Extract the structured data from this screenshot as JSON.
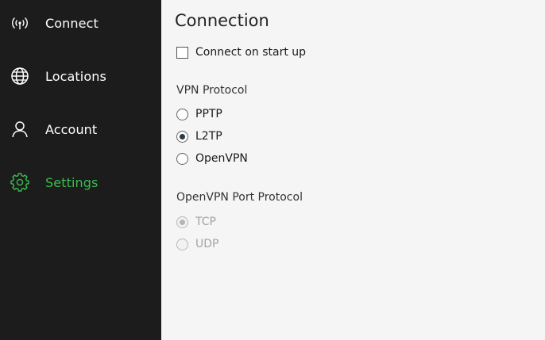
{
  "sidebar": {
    "items": [
      {
        "label": "Connect",
        "icon": "antenna-icon"
      },
      {
        "label": "Locations",
        "icon": "globe-icon"
      },
      {
        "label": "Account",
        "icon": "user-icon"
      },
      {
        "label": "Settings",
        "icon": "gear-icon",
        "active": true
      }
    ],
    "background": "#1c1c1c",
    "accent": "#3bbd4e"
  },
  "main": {
    "title": "Connection",
    "connect_on_startup": {
      "label": "Connect on start up",
      "checked": false
    },
    "vpn_protocol": {
      "label": "VPN Protocol",
      "options": [
        {
          "label": "PPTP",
          "checked": false
        },
        {
          "label": "L2TP",
          "checked": true
        },
        {
          "label": "OpenVPN",
          "checked": false
        }
      ]
    },
    "openvpn_port_protocol": {
      "label": "OpenVPN Port Protocol",
      "disabled": true,
      "options": [
        {
          "label": "TCP",
          "checked": true
        },
        {
          "label": "UDP",
          "checked": false
        }
      ]
    }
  }
}
